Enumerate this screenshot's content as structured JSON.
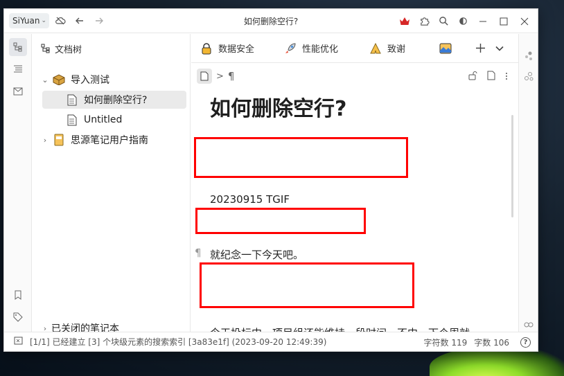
{
  "app": {
    "name": "SiYuan",
    "window_title": "如何删除空行?"
  },
  "colors": {
    "accent_red": "#ff0000",
    "selected_bg": "#eaeaea"
  },
  "tree": {
    "header": "文档树",
    "notebook": {
      "name": "导入测试",
      "icon": "package-icon"
    },
    "docs": [
      {
        "name": "如何删除空行?",
        "selected": true
      },
      {
        "name": "Untitled",
        "selected": false
      }
    ],
    "guide": "思源笔记用户指南",
    "closed": "已关闭的笔记本"
  },
  "tabs": [
    {
      "label": "数据安全",
      "icon": "lock-emoji-icon"
    },
    {
      "label": "性能优化",
      "icon": "rocket-emoji-icon"
    },
    {
      "label": "致谢",
      "icon": "pray-emoji-icon"
    }
  ],
  "breadcrumb": {
    "separator": ">",
    "paragraph_symbol": "¶"
  },
  "editor": {
    "title": "如何删除空行?",
    "paragraphs": {
      "date": "20230915 TGIF",
      "memo": "就纪念一下今天吧。",
      "body": "今天投标中，项目组还能维持一段时间，不中，下个周就"
    }
  },
  "status": {
    "message": "[1/1] 已经建立 [3] 个块级元素的搜索索引 [3a83e1f] (2023-09-20 12:49:39)",
    "char_count": "字符数 119",
    "word_count": "字数 106",
    "help": "?"
  }
}
